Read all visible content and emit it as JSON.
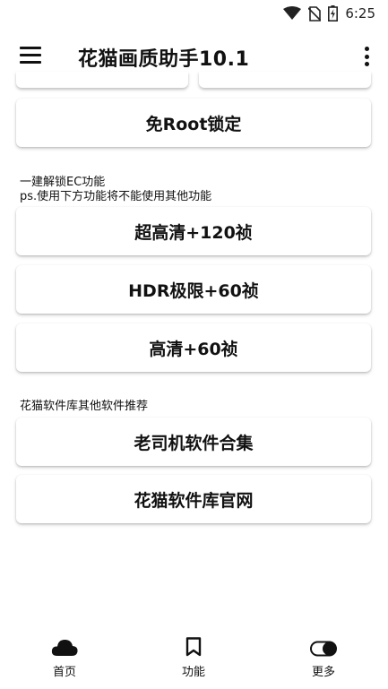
{
  "status_bar": {
    "time": "6:25",
    "icons": [
      "wifi-icon",
      "no-sim-icon",
      "battery-charging-icon"
    ]
  },
  "app_bar": {
    "title": "花猫画质助手10.1",
    "menu_icon": "hamburger-menu-icon",
    "overflow_icon": "more-vert-icon"
  },
  "main": {
    "lock_button": "免Root锁定",
    "ec_section": {
      "label_line1": "一建解锁EC功能",
      "label_line2": "ps.使用下方功能将不能使用其他功能",
      "buttons": [
        "超高清+120祯",
        "HDR极限+60祯",
        "高清+60祯"
      ]
    },
    "software_section": {
      "label": "花猫软件库其他软件推荐",
      "buttons": [
        "老司机软件合集",
        "花猫软件库官网"
      ]
    }
  },
  "bottom_nav": {
    "items": [
      {
        "label": "首页",
        "icon": "cloud-icon"
      },
      {
        "label": "功能",
        "icon": "bookmark-icon"
      },
      {
        "label": "更多",
        "icon": "toggle-icon"
      }
    ]
  }
}
